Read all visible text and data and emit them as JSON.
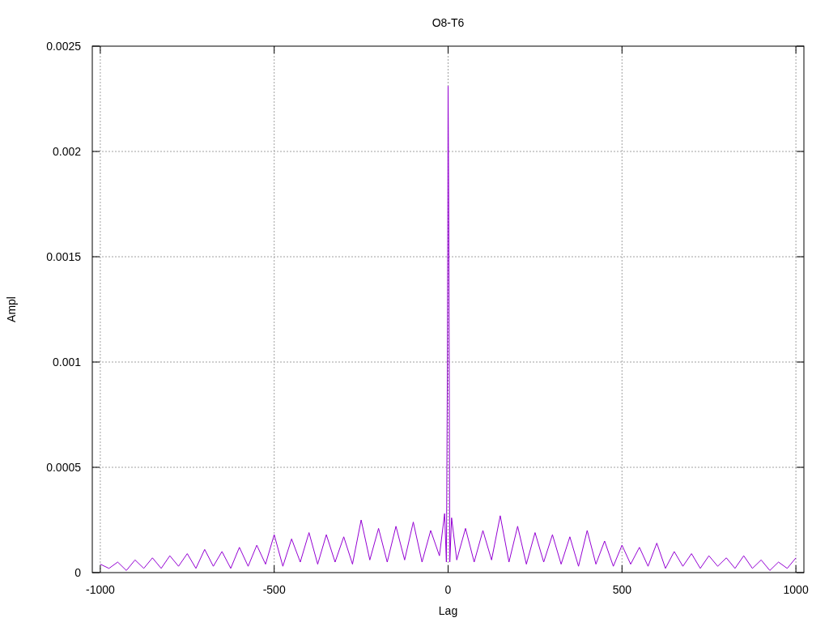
{
  "chart_data": {
    "type": "line",
    "title": "O8-T6",
    "xlabel": "Lag",
    "ylabel": "Ampl",
    "xlim": [
      -1023,
      1023
    ],
    "ylim": [
      0,
      0.0025
    ],
    "xticks": [
      -1000,
      -500,
      0,
      500,
      1000
    ],
    "yticks": [
      {
        "value": 0,
        "label": "0"
      },
      {
        "value": 0.0005,
        "label": "0.0005"
      },
      {
        "value": 0.001,
        "label": "0.001"
      },
      {
        "value": 0.0015,
        "label": "0.0015"
      },
      {
        "value": 0.002,
        "label": "0.002"
      },
      {
        "value": 0.0025,
        "label": "0.0025"
      }
    ],
    "x": [
      -1000,
      -975,
      -950,
      -925,
      -900,
      -875,
      -850,
      -825,
      -800,
      -775,
      -750,
      -725,
      -700,
      -675,
      -650,
      -625,
      -600,
      -575,
      -550,
      -525,
      -500,
      -475,
      -450,
      -425,
      -400,
      -375,
      -350,
      -325,
      -300,
      -275,
      -250,
      -225,
      -200,
      -175,
      -150,
      -125,
      -100,
      -75,
      -50,
      -25,
      -10,
      -5,
      -2,
      0,
      2,
      5,
      10,
      25,
      50,
      75,
      100,
      125,
      150,
      175,
      200,
      225,
      250,
      275,
      300,
      325,
      350,
      375,
      400,
      425,
      450,
      475,
      500,
      525,
      550,
      575,
      600,
      625,
      650,
      675,
      700,
      725,
      750,
      775,
      800,
      825,
      850,
      875,
      900,
      925,
      950,
      975,
      1000
    ],
    "grid": true,
    "series": [
      {
        "color": "#9400d3",
        "values": [
          4e-05,
          2e-05,
          5e-05,
          1e-05,
          6e-05,
          2e-05,
          7e-05,
          2e-05,
          8e-05,
          3e-05,
          9e-05,
          2e-05,
          0.00011,
          3e-05,
          0.0001,
          2e-05,
          0.00012,
          3e-05,
          0.00013,
          4e-05,
          0.00018,
          3e-05,
          0.00016,
          5e-05,
          0.00019,
          4e-05,
          0.00018,
          5e-05,
          0.00017,
          4e-05,
          0.00025,
          6e-05,
          0.00021,
          5e-05,
          0.00022,
          6e-05,
          0.00024,
          5e-05,
          0.0002,
          8e-05,
          0.00028,
          5e-05,
          0.00095,
          0.00231,
          0.00167,
          5e-05,
          0.00026,
          6e-05,
          0.00021,
          5e-05,
          0.0002,
          6e-05,
          0.00027,
          5e-05,
          0.00022,
          4e-05,
          0.00019,
          5e-05,
          0.00018,
          4e-05,
          0.00017,
          3e-05,
          0.0002,
          4e-05,
          0.00015,
          3e-05,
          0.00013,
          4e-05,
          0.00012,
          3e-05,
          0.00014,
          2e-05,
          0.0001,
          3e-05,
          9e-05,
          2e-05,
          8e-05,
          3e-05,
          7e-05,
          2e-05,
          8e-05,
          2e-05,
          6e-05,
          1e-05,
          5e-05,
          2e-05,
          7e-05
        ]
      }
    ]
  }
}
